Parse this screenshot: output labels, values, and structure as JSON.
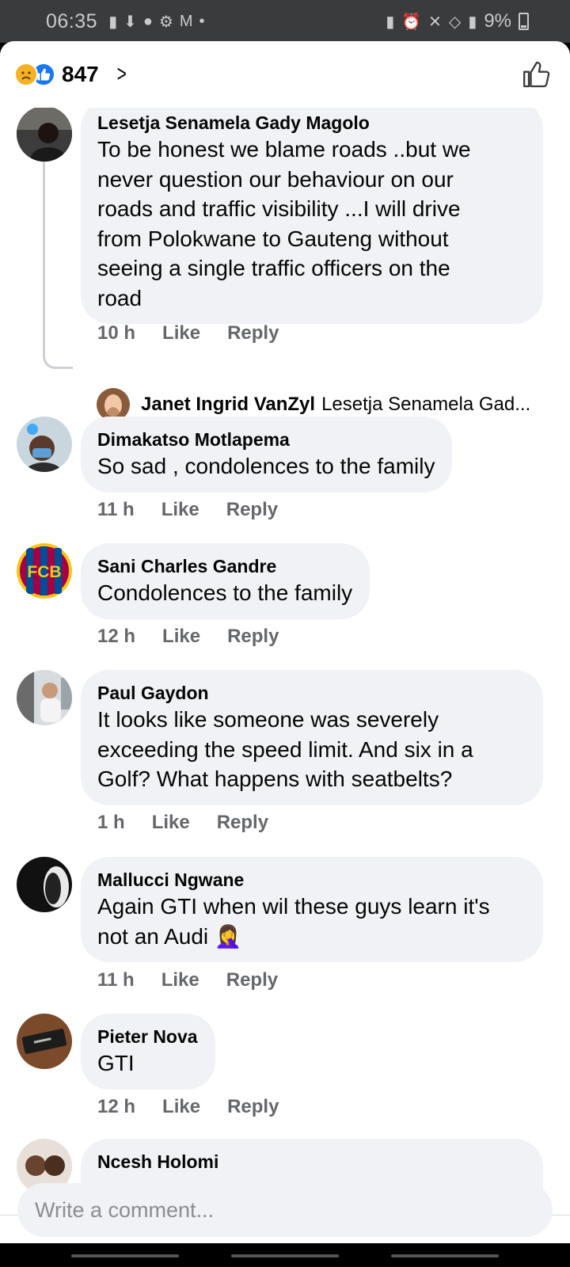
{
  "status_bar": {
    "time": "06:35",
    "battery": "9%",
    "left_icons": [
      "message-icon",
      "download-icon",
      "notification-icon",
      "settings-icon",
      "gmail-icon"
    ],
    "right_icons": [
      "lock-icon",
      "alarm-icon",
      "mute-icon",
      "wifi-icon",
      "signal-icon"
    ]
  },
  "reactions": {
    "count": "847",
    "types": [
      "sad",
      "like"
    ]
  },
  "comments": [
    {
      "author": "Lesetja Senamela Gady Magolo",
      "lines": [
        "To be honest we blame roads ..but we",
        "never question our behaviour on our",
        "roads and traffic visibility ...I will drive",
        "from Polokwane to Gauteng without",
        "seeing a single traffic officers on the",
        "road"
      ],
      "time": "10 h",
      "like": "Like",
      "reply": "Reply"
    },
    {
      "author": "Dimakatso Motlapema",
      "lines": [
        "So sad , condolences to the family"
      ],
      "time": "11 h",
      "like": "Like",
      "reply": "Reply"
    },
    {
      "author": "Sani Charles Gandre",
      "lines": [
        "Condolences to the family"
      ],
      "time": "12 h",
      "like": "Like",
      "reply": "Reply"
    },
    {
      "author": "Paul Gaydon",
      "lines": [
        "It looks like someone was severely",
        "exceeding the speed limit. And six in a",
        "Golf? What happens with seatbelts?"
      ],
      "time": "1 h",
      "like": "Like",
      "reply": "Reply"
    },
    {
      "author": "Mallucci Ngwane",
      "lines": [
        "Again GTI when wil these guys learn it's",
        "not an Audi 🤦‍♀️"
      ],
      "time": "11 h",
      "like": "Like",
      "reply": "Reply"
    },
    {
      "author": "Pieter Nova",
      "lines": [
        "GTI"
      ],
      "time": "12 h",
      "like": "Like",
      "reply": "Reply"
    },
    {
      "author": "Ncesh Holomi"
    }
  ],
  "reply_preview": {
    "author": "Janet Ingrid VanZyl",
    "text": "Lesetja Senamela Gad..."
  },
  "avatar_badge": "FCB",
  "composer": {
    "placeholder": "Write a comment..."
  },
  "colors": {
    "bubble": "#f0f2f5",
    "like_blue": "#1877f2",
    "secondary_text": "#65676b",
    "status_bar": "#3a3b3c"
  }
}
